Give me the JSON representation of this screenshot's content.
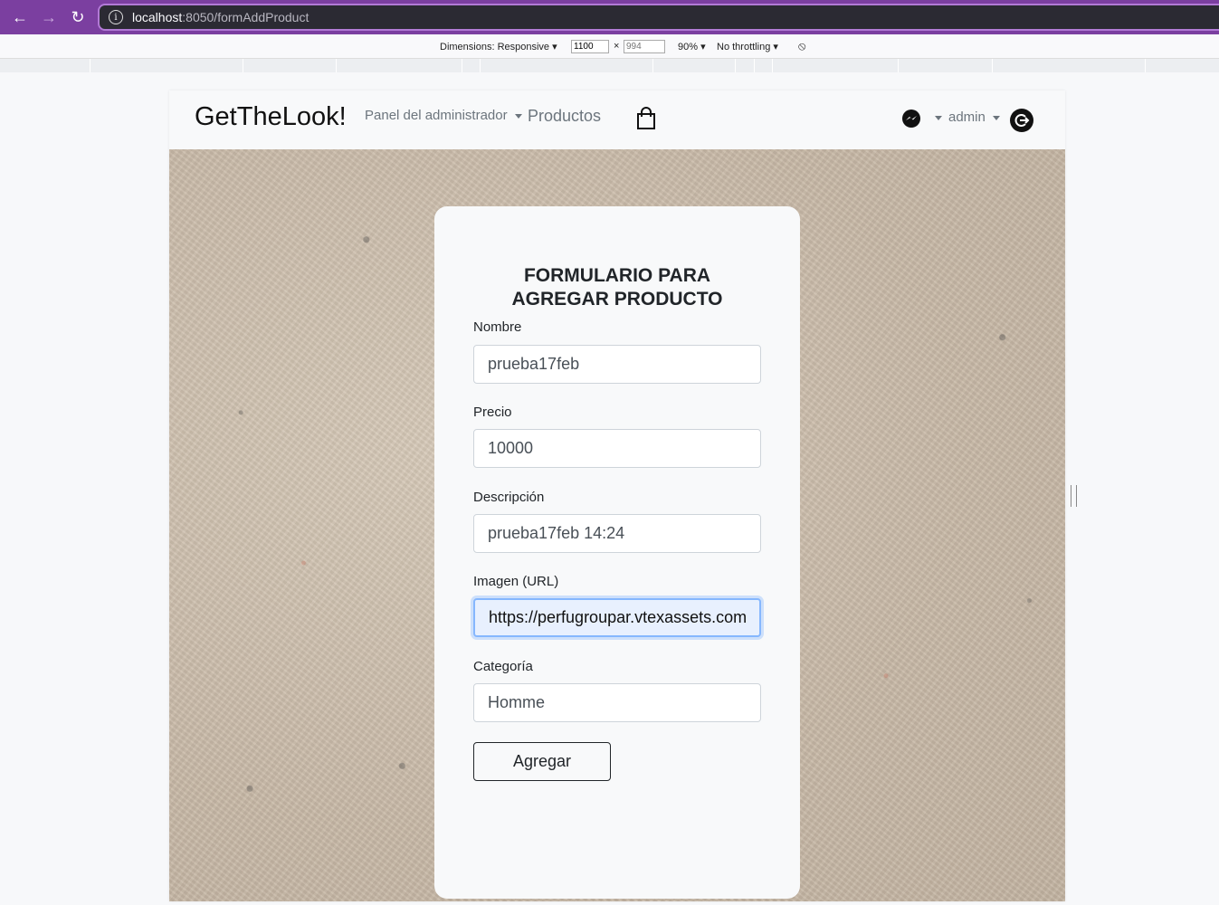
{
  "browser": {
    "url_host": "localhost",
    "url_path": ":8050/formAddProduct"
  },
  "devtools": {
    "dimensions_label": "Dimensions: Responsive",
    "width": "1100",
    "height_placeholder": "994",
    "times": "×",
    "zoom": "90%",
    "throttling": "No throttling"
  },
  "navbar": {
    "brand": "GetTheLook!",
    "admin_panel": "Panel del administrador",
    "products": "Productos",
    "user": "admin"
  },
  "form": {
    "title_line1": "FORMULARIO PARA",
    "title_line2": "AGREGAR PRODUCTO",
    "fields": [
      {
        "label": "Nombre",
        "value": "prueba17feb"
      },
      {
        "label": "Precio",
        "value": "10000"
      },
      {
        "label": "Descripción",
        "value": "prueba17feb 14:24"
      },
      {
        "label": "Imagen (URL)",
        "value": "https://perfugroupar.vtexassets.com/"
      },
      {
        "label": "Categoría",
        "value": "Homme"
      }
    ],
    "submit": "Agregar"
  },
  "colors": {
    "browser_accent": "#7b3fa0",
    "focus_ring": "#86b7fe",
    "navbar_bg": "#f8f9fa"
  }
}
